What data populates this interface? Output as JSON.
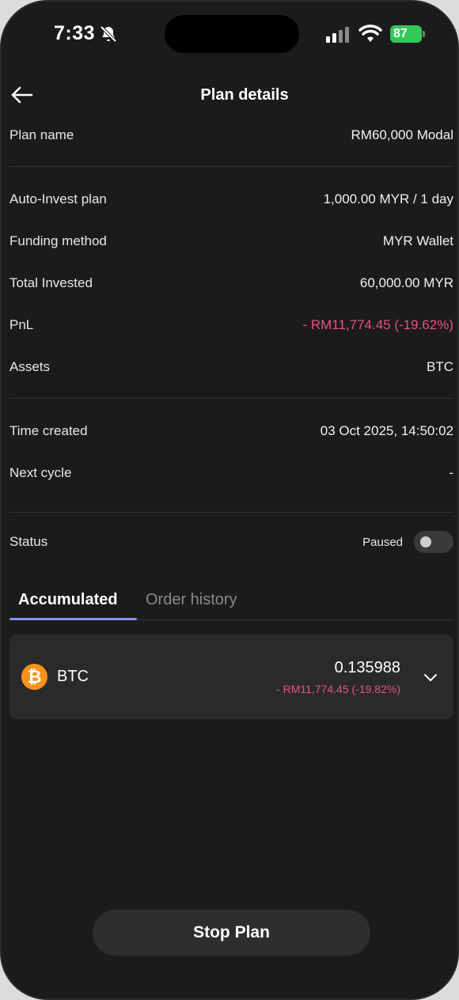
{
  "status_bar": {
    "time": "7:33",
    "battery": "87",
    "icons": [
      "bell-slash-icon",
      "signal-icon",
      "wifi-icon",
      "battery-icon"
    ]
  },
  "header": {
    "title": "Plan details",
    "back_icon": "arrow-left-icon"
  },
  "details": {
    "plan_name": {
      "label": "Plan name",
      "value": "RM60,000 Modal"
    },
    "auto_invest": {
      "label": "Auto-Invest plan",
      "value": "1,000.00 MYR / 1 day"
    },
    "funding_method": {
      "label": "Funding method",
      "value": "MYR Wallet"
    },
    "total_invested": {
      "label": "Total Invested",
      "value": "60,000.00 MYR"
    },
    "pnl": {
      "label": "PnL",
      "value": "- RM11,774.45 (-19.62%)"
    },
    "assets": {
      "label": "Assets",
      "value": "BTC"
    },
    "time_created": {
      "label": "Time created",
      "value": "03 Oct 2025, 14:50:02"
    },
    "next_cycle": {
      "label": "Next cycle",
      "value": "-"
    },
    "status": {
      "label": "Status",
      "value": "Paused",
      "toggle_on": false
    }
  },
  "tabs": [
    {
      "label": "Accumulated",
      "active": true
    },
    {
      "label": "Order history",
      "active": false
    }
  ],
  "asset": {
    "symbol": "BTC",
    "coin_glyph": "₿",
    "amount": "0.135988",
    "pnl": "- RM11,774.45 (-19.82%)"
  },
  "actions": {
    "stop_label": "Stop Plan"
  },
  "colors": {
    "background": "#1b1b1d",
    "negative": "#e8537a",
    "accent": "#7b93f2",
    "btc": "#f7931a",
    "battery": "#34c759"
  }
}
